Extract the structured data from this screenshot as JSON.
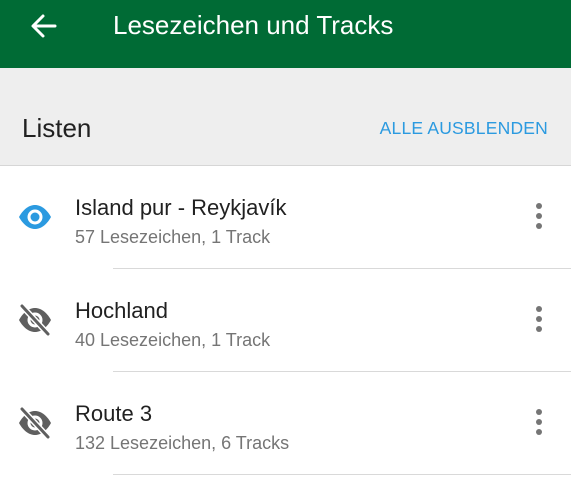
{
  "app_bar": {
    "title": "Lesezeichen und Tracks",
    "background": "#006b35",
    "back_icon": "arrow-back-icon"
  },
  "section": {
    "title": "Listen",
    "action_label": "ALLE AUSBLENDEN",
    "action_color": "#2b9ae0"
  },
  "lists": [
    {
      "name": "Island pur - Reykjavík",
      "subtitle": "57 Lesezeichen, 1 Track",
      "visible": true,
      "icon": "eye-icon",
      "icon_color": "#2b9ae0"
    },
    {
      "name": "Hochland",
      "subtitle": "40 Lesezeichen, 1 Track",
      "visible": false,
      "icon": "eye-off-icon",
      "icon_color": "#5f5f5f"
    },
    {
      "name": "Route 3",
      "subtitle": "132 Lesezeichen, 6 Tracks",
      "visible": false,
      "icon": "eye-off-icon",
      "icon_color": "#5f5f5f"
    }
  ]
}
